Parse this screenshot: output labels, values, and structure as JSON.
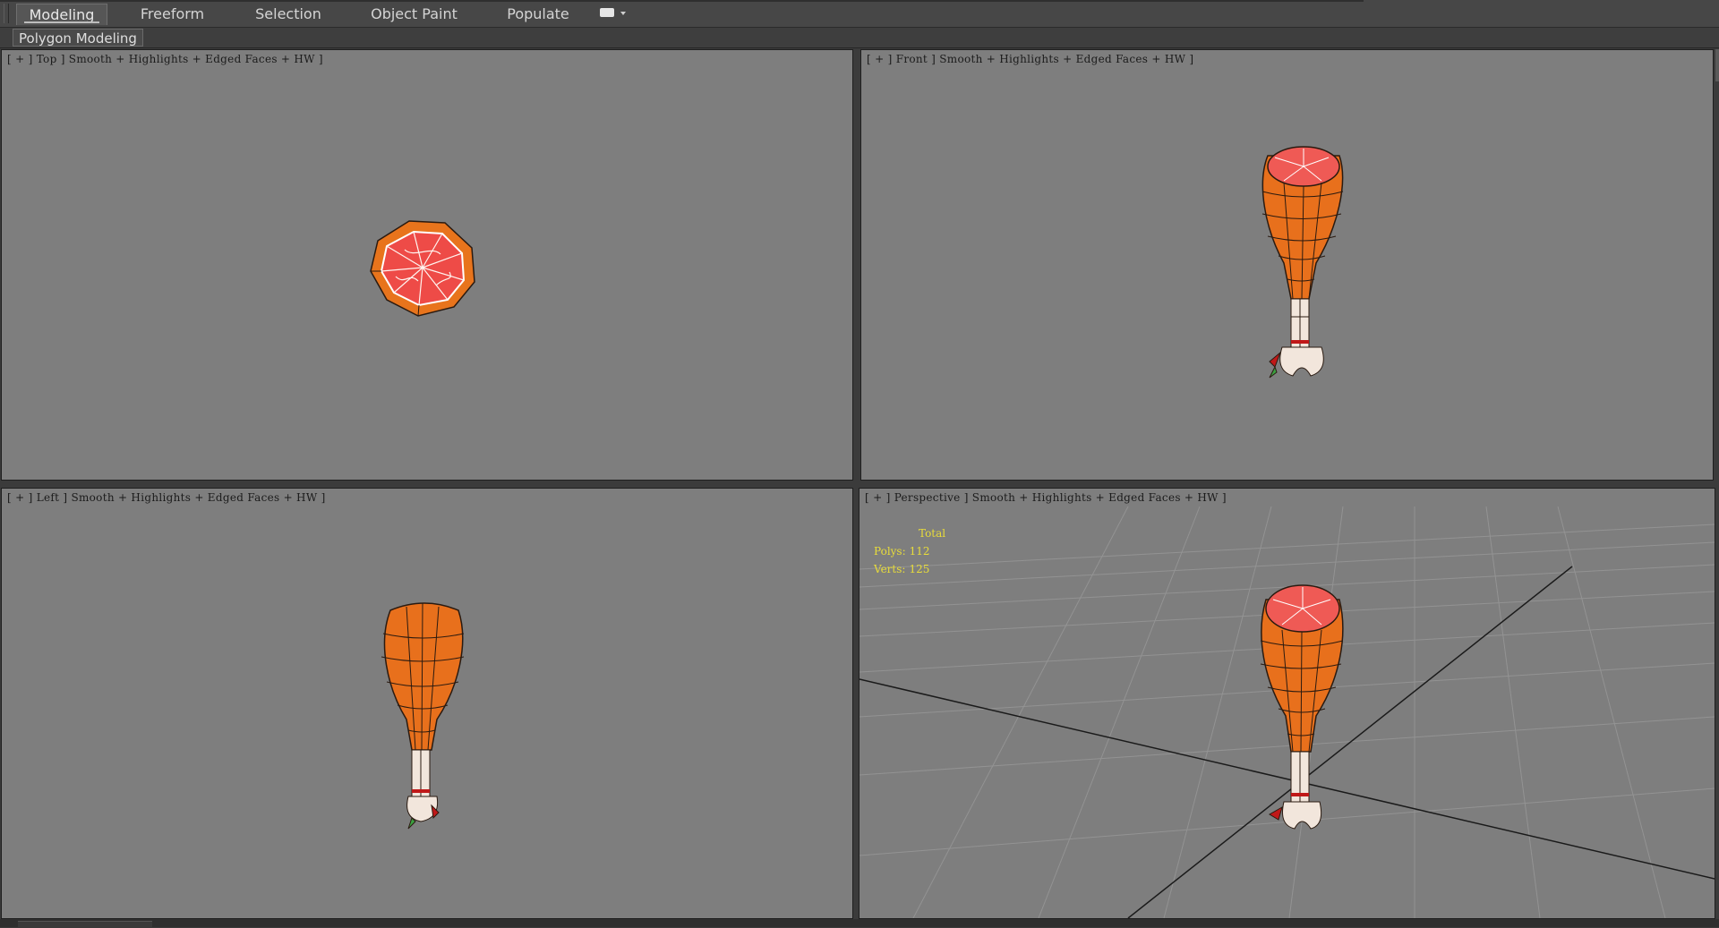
{
  "ribbon": {
    "tabs": [
      {
        "label": "Modeling"
      },
      {
        "label": "Freeform"
      },
      {
        "label": "Selection"
      },
      {
        "label": "Object Paint"
      },
      {
        "label": "Populate"
      }
    ],
    "active_tab": "Modeling",
    "panel_label": "Polygon Modeling"
  },
  "viewports": {
    "top": {
      "menu_plus": "+",
      "view": "Top",
      "shading": "Smooth + Highlights + Edged Faces + HW"
    },
    "front": {
      "menu_plus": "+",
      "view": "Front",
      "shading": "Smooth + Highlights + Edged Faces + HW"
    },
    "left": {
      "menu_plus": "+",
      "view": "Left",
      "shading": "Smooth + Highlights + Edged Faces + HW"
    },
    "perspective": {
      "menu_plus": "+",
      "view": "Perspective",
      "shading": "Smooth + Highlights + Edged Faces + HW",
      "stats": {
        "total_label": "Total",
        "polys_label": "Polys:",
        "polys_value": "112",
        "verts_label": "Verts:",
        "verts_value": "125"
      }
    }
  },
  "colors": {
    "viewport_bg": "#7e7e7e",
    "mesh_skin": "#e8701c",
    "mesh_meat": "#f05550",
    "stats_text": "#e8dc3a"
  }
}
